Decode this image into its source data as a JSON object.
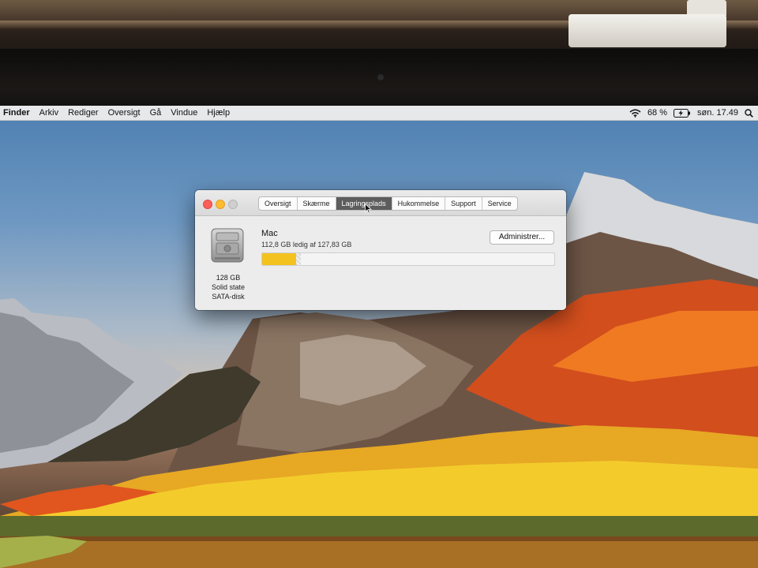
{
  "menubar": {
    "app_name": "Finder",
    "items": [
      "Arkiv",
      "Rediger",
      "Oversigt",
      "Gå",
      "Vindue",
      "Hjælp"
    ],
    "battery_percent": "68 %",
    "clock": "søn. 17.49",
    "icons": [
      "wifi-icon",
      "battery-charging-icon",
      "spotlight-search-icon"
    ]
  },
  "window": {
    "tabs": [
      "Oversigt",
      "Skærme",
      "Lagringsplads",
      "Hukommelse",
      "Support",
      "Service"
    ],
    "selected_tab": "Lagringsplads",
    "disk": {
      "icon": "hard-disk-icon",
      "capacity": "128 GB",
      "type_line1": "Solid state",
      "type_line2": "SATA-disk"
    },
    "volume": {
      "name": "Mac",
      "free_text": "112,8 GB ledig af 127,83 GB",
      "used_fraction": 0.117,
      "used_color": "#f3c21f"
    },
    "manage_button": "Administrer..."
  }
}
